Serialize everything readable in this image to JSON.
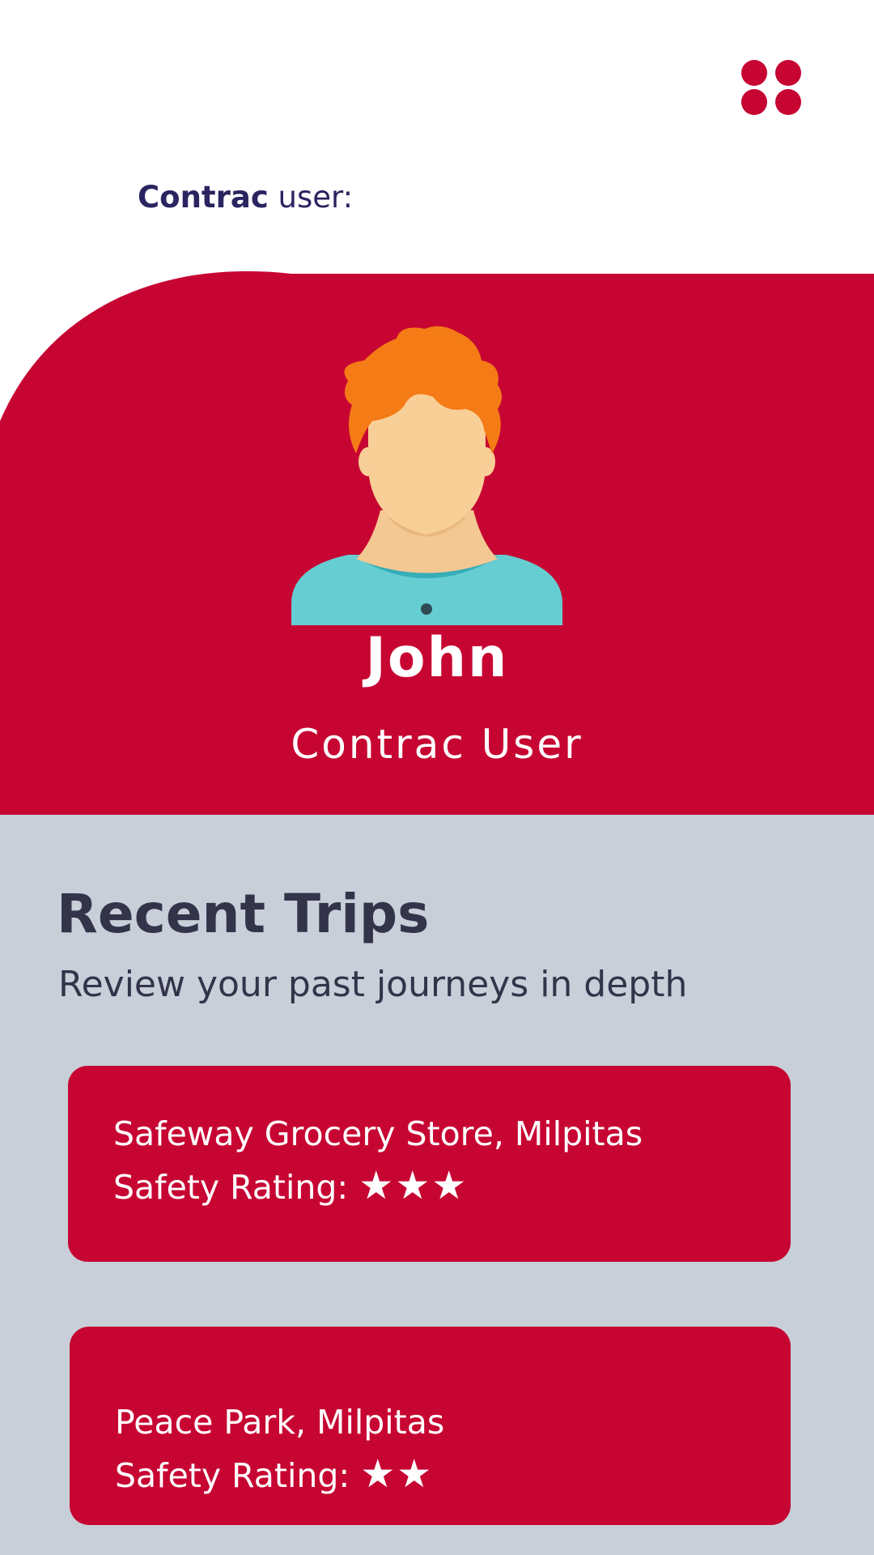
{
  "header": {
    "menu_icon": "grid-menu-icon",
    "user_line_brand": "Contrac",
    "user_line_suffix": " user:"
  },
  "profile": {
    "avatar_icon": "user-avatar-illustration",
    "name": "John",
    "role": "Contrac User"
  },
  "recent_trips": {
    "title": "Recent Trips",
    "subtitle": "Review your past journeys in depth",
    "trips": [
      {
        "place": "Safeway Grocery Store, Milpitas",
        "rating_label": "Safety Rating: ",
        "rating_stars": "★★★",
        "rating": 3
      },
      {
        "place": "Peace Park, Milpitas",
        "rating_label": "Safety Rating: ",
        "rating_stars": "★★",
        "rating": 2
      }
    ]
  },
  "colors": {
    "accent": "#c70532",
    "background": "#ffffff",
    "section_bg": "#c8cfd9",
    "heading_text": "#33344a",
    "brand_text": "#2a2460"
  }
}
